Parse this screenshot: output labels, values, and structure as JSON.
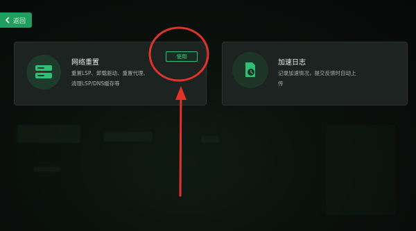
{
  "back_button": {
    "label": "返回"
  },
  "cards": [
    {
      "title": "网络重置",
      "description_line1": "重置LSP、卸载驱动、重置代理、",
      "description_line2": "清理LSP/DNS缓存等",
      "action_label": "使用",
      "icon": "server-stack-icon"
    },
    {
      "title": "加速日志",
      "description_line1": "记录加速情况，提交反馈时自动上",
      "description_line2": "传",
      "icon": "log-clock-icon"
    }
  ],
  "colors": {
    "accent": "#1f9e5d",
    "annotation": "#e0342a",
    "card_bg": "#1c2321"
  }
}
